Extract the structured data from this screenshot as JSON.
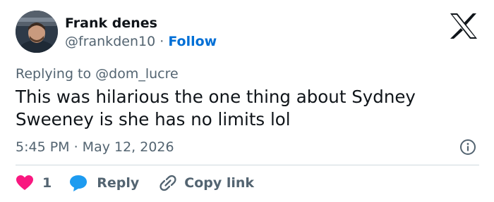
{
  "author": {
    "name": "Frank denes",
    "handle": "@frankden10",
    "separator": "·",
    "follow_label": "Follow"
  },
  "reply_context": "Replying to @dom_lucre",
  "tweet": {
    "text": "This was hilarious the one thing about Sydney Sweeney is she has no limits lol"
  },
  "timestamp": "5:45 PM · May 12, 2026",
  "actions": {
    "like_count": "1",
    "reply_label": "Reply",
    "copy_link_label": "Copy link"
  },
  "colors": {
    "like": "#f91880",
    "reply": "#1d9bf0",
    "follow": "#006fd6",
    "secondary_text": "#536471"
  },
  "icons": {
    "logo": "x-logo-icon",
    "info": "info-icon",
    "like": "heart-icon",
    "reply": "speech-bubble-icon",
    "copy": "link-icon"
  }
}
